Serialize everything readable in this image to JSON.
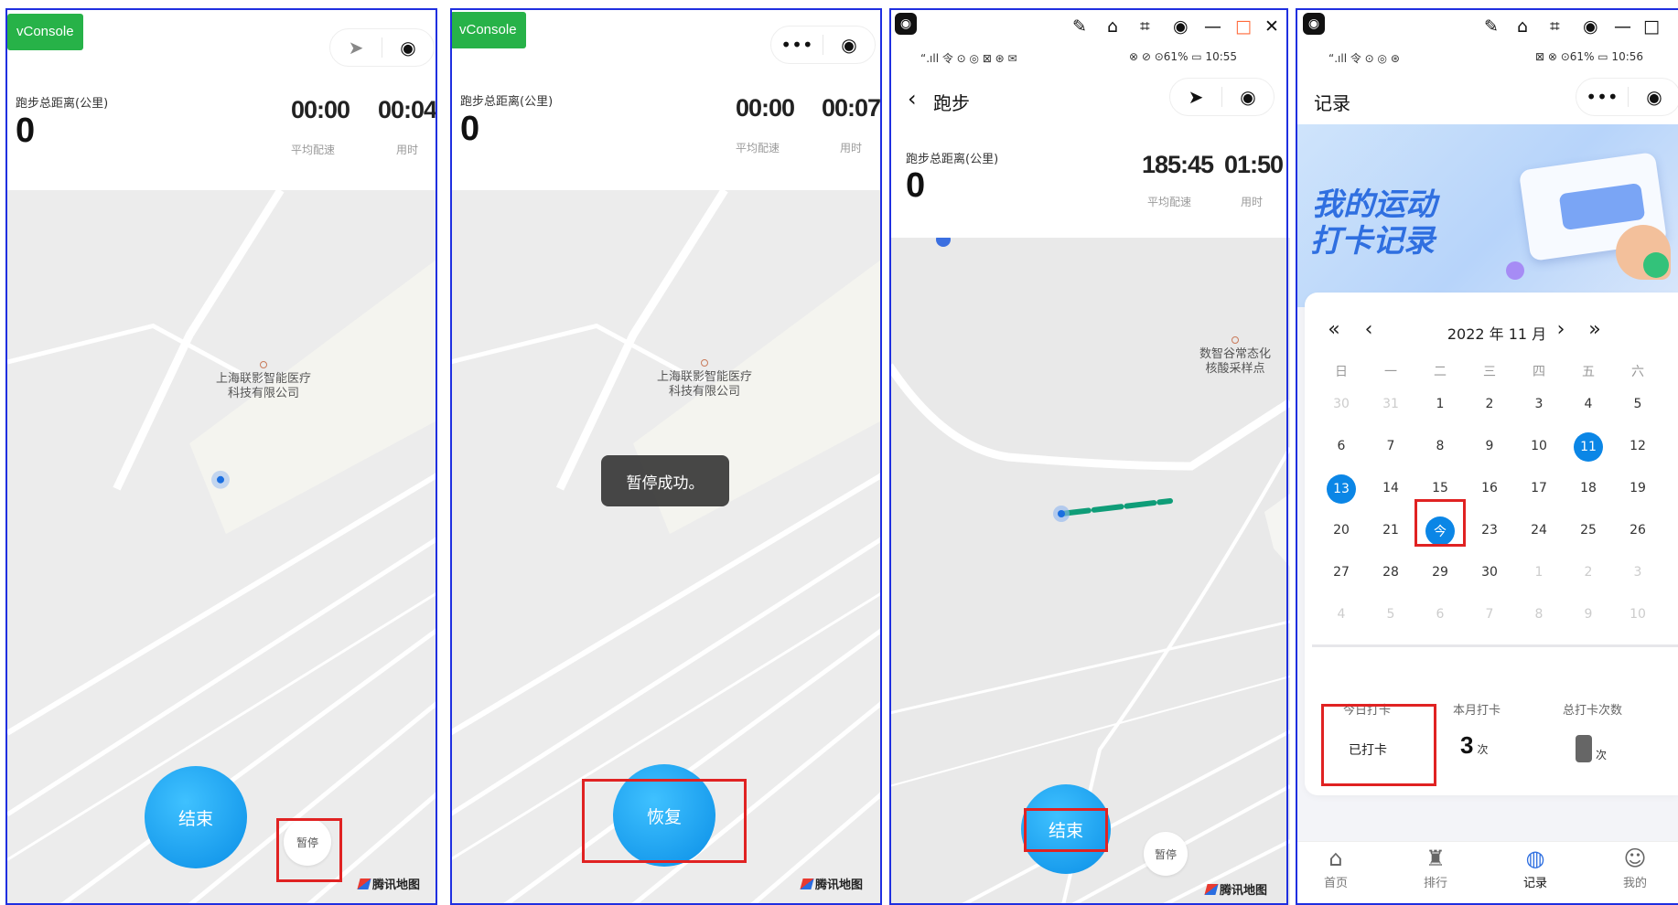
{
  "colors": {
    "accent": "#0b86e6",
    "vconsole": "#27b248",
    "highlight": "#e02222",
    "frame": "#1f2fe0"
  },
  "panel1": {
    "vconsole": "vConsole",
    "capsule": {
      "left_icon": "location-arrow-icon",
      "right_icon": "record-target-icon"
    },
    "distance_label": "跑步总距离(公里)",
    "distance_value": "0",
    "pace_value": "00:00",
    "pace_label": "平均配速",
    "time_value": "00:04",
    "time_label": "用时",
    "poi": [
      "上海联影智能医疗",
      "科技有限公司"
    ],
    "end_button": "结束",
    "pause_button": "暂停",
    "map_logo": "腾讯地图"
  },
  "panel2": {
    "vconsole": "vConsole",
    "capsule": {
      "left_icon": "more-dots-icon",
      "right_icon": "record-target-icon"
    },
    "distance_label": "跑步总距离(公里)",
    "distance_value": "0",
    "pace_value": "00:00",
    "pace_label": "平均配速",
    "time_value": "00:07",
    "time_label": "用时",
    "poi": [
      "上海联影智能医疗",
      "科技有限公司"
    ],
    "toast": "暂停成功。",
    "resume_button": "恢复",
    "map_logo": "腾讯地图"
  },
  "panel3": {
    "status_left": "“.ıll 令 ⊙ ◎ ⊠ ⊛ ✉",
    "status_right": "⊗ ⊘ ⊙61% ▭ 10:55",
    "title": "跑步",
    "capsule": {
      "left_icon": "location-arrow-icon",
      "right_icon": "record-target-icon"
    },
    "distance_label": "跑步总距离(公里)",
    "distance_value": "0",
    "pace_value": "185:45",
    "pace_label": "平均配速",
    "time_value": "01:50",
    "time_label": "用时",
    "poi": [
      "数智谷常态化",
      "核酸采样点"
    ],
    "end_button": "结束",
    "pause_button": "暂停",
    "map_logo": "腾讯地图"
  },
  "panel4": {
    "status_left": "“.ıll 令 ⊙ ◎ ⊛",
    "status_right": "⊠ ⊗ ⊙61% ▭ 10:56",
    "title": "记录",
    "banner": [
      "我的运动",
      "打卡记录"
    ],
    "calendar": {
      "nav": [
        "«",
        "‹",
        "›",
        "»"
      ],
      "month": "2022 年 11 月",
      "weekdays": [
        "日",
        "一",
        "二",
        "三",
        "四",
        "五",
        "六"
      ],
      "rows": [
        [
          "30",
          "31",
          "1",
          "2",
          "3",
          "4",
          "5"
        ],
        [
          "6",
          "7",
          "8",
          "9",
          "10",
          "11",
          "12"
        ],
        [
          "13",
          "14",
          "15",
          "16",
          "17",
          "18",
          "19"
        ],
        [
          "20",
          "21",
          "今",
          "23",
          "24",
          "25",
          "26"
        ],
        [
          "27",
          "28",
          "29",
          "30",
          "1",
          "2",
          "3"
        ],
        [
          "4",
          "5",
          "6",
          "7",
          "8",
          "9",
          "10"
        ]
      ]
    },
    "summary": {
      "today_label": "今日打卡",
      "today_value": "已打卡",
      "month_label": "本月打卡",
      "month_value": "3",
      "month_unit": "次",
      "total_label": "总打卡次数",
      "total_unit": "次"
    },
    "tabs": [
      {
        "label": "首页",
        "icon": "home-icon"
      },
      {
        "label": "排行",
        "icon": "trophy-icon"
      },
      {
        "label": "记录",
        "icon": "planet-icon"
      },
      {
        "label": "我的",
        "icon": "profile-icon"
      }
    ]
  }
}
